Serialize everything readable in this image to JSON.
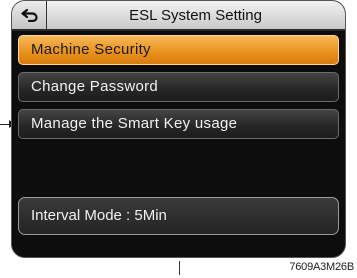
{
  "header": {
    "title": "ESL System Setting",
    "back_icon": "back-arrow-icon"
  },
  "menu": {
    "items": [
      {
        "label": "Machine Security",
        "selected": true
      },
      {
        "label": "Change Password",
        "selected": false
      },
      {
        "label": "Manage the Smart Key usage",
        "selected": false
      }
    ]
  },
  "status": {
    "interval": "Interval Mode : 5Min"
  },
  "figure": {
    "code": "7609A3M26B"
  },
  "colors": {
    "selected_accent": "#e8901a",
    "screen_background": "#0d0d0d",
    "header_background": "#d8d8d8"
  }
}
